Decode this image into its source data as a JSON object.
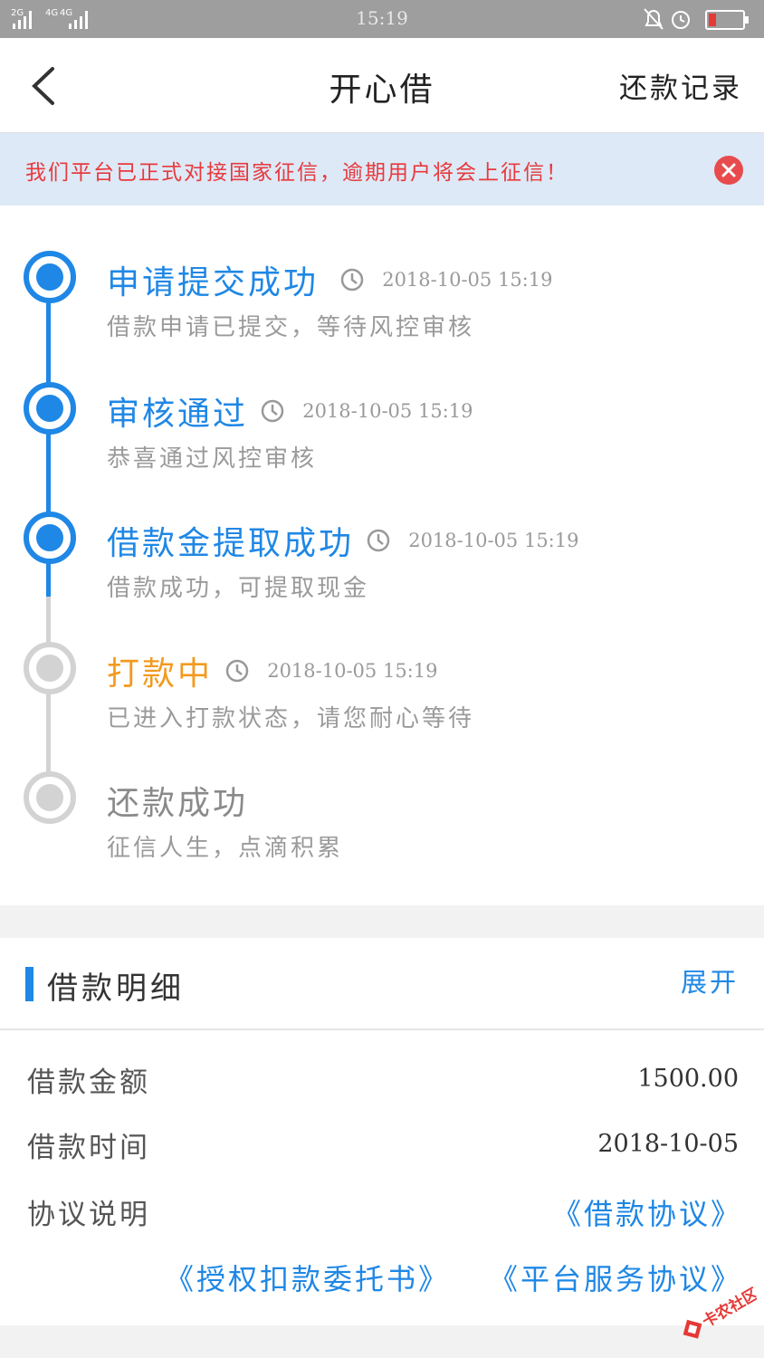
{
  "status_bar": {
    "network": "2G 4G 4G",
    "time": "15:19"
  },
  "nav": {
    "title": "开心借",
    "right_link": "还款记录"
  },
  "notice": {
    "text": "我们平台已正式对接国家征信，逾期用户将会上征信！"
  },
  "timeline": {
    "steps": [
      {
        "title": "申请提交成功",
        "time": "2018-10-05 15:19",
        "desc": "借款申请已提交，等待风控审核",
        "state": "done"
      },
      {
        "title": "审核通过",
        "time": "2018-10-05 15:19",
        "desc": "恭喜通过风控审核",
        "state": "done"
      },
      {
        "title": "借款金提取成功",
        "time": "2018-10-05 15:19",
        "desc": "借款成功，可提取现金",
        "state": "done"
      },
      {
        "title": "打款中",
        "time": "2018-10-05 15:19",
        "desc": "已进入打款状态，请您耐心等待",
        "state": "current"
      },
      {
        "title": "还款成功",
        "time": "",
        "desc": "征信人生，点滴积累",
        "state": "todo"
      }
    ]
  },
  "details": {
    "title": "借款明细",
    "expand": "展开",
    "rows": [
      {
        "label": "借款金额",
        "value": "1500.00"
      },
      {
        "label": "借款时间",
        "value": "2018-10-05"
      },
      {
        "label": "协议说明",
        "value": "《借款协议》"
      }
    ],
    "extra_agreements": [
      "《授权扣款委托书》",
      "《平台服务协议》"
    ]
  },
  "watermark": {
    "text": "卡农社区"
  },
  "colors": {
    "accent_blue": "#1f87e5",
    "orange": "#f39a1e",
    "notice_red": "#e8393d",
    "inactive_gray": "#d3d3d3"
  }
}
